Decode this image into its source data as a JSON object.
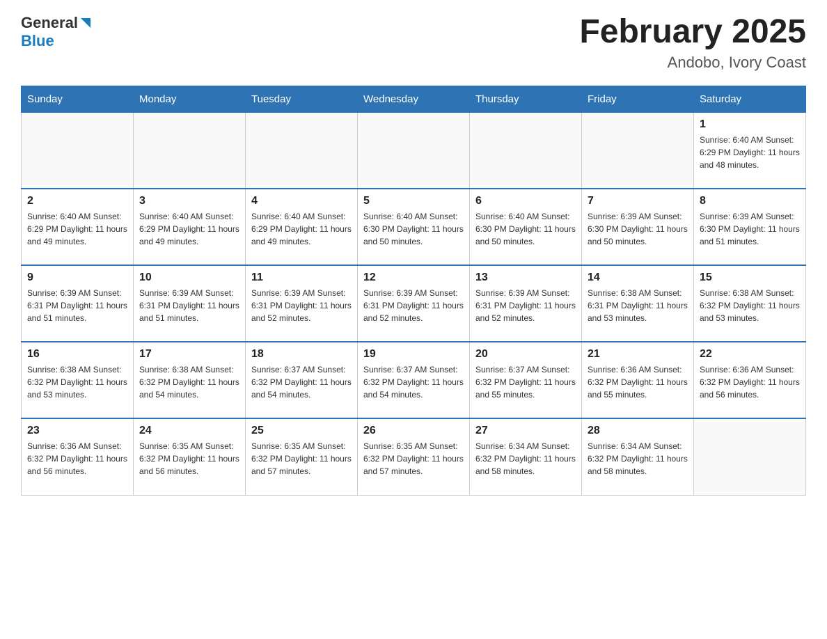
{
  "header": {
    "logo_general": "General",
    "logo_blue": "Blue",
    "month_title": "February 2025",
    "location": "Andobo, Ivory Coast"
  },
  "weekdays": [
    "Sunday",
    "Monday",
    "Tuesday",
    "Wednesday",
    "Thursday",
    "Friday",
    "Saturday"
  ],
  "weeks": [
    [
      {
        "day": "",
        "info": ""
      },
      {
        "day": "",
        "info": ""
      },
      {
        "day": "",
        "info": ""
      },
      {
        "day": "",
        "info": ""
      },
      {
        "day": "",
        "info": ""
      },
      {
        "day": "",
        "info": ""
      },
      {
        "day": "1",
        "info": "Sunrise: 6:40 AM\nSunset: 6:29 PM\nDaylight: 11 hours\nand 48 minutes."
      }
    ],
    [
      {
        "day": "2",
        "info": "Sunrise: 6:40 AM\nSunset: 6:29 PM\nDaylight: 11 hours\nand 49 minutes."
      },
      {
        "day": "3",
        "info": "Sunrise: 6:40 AM\nSunset: 6:29 PM\nDaylight: 11 hours\nand 49 minutes."
      },
      {
        "day": "4",
        "info": "Sunrise: 6:40 AM\nSunset: 6:29 PM\nDaylight: 11 hours\nand 49 minutes."
      },
      {
        "day": "5",
        "info": "Sunrise: 6:40 AM\nSunset: 6:30 PM\nDaylight: 11 hours\nand 50 minutes."
      },
      {
        "day": "6",
        "info": "Sunrise: 6:40 AM\nSunset: 6:30 PM\nDaylight: 11 hours\nand 50 minutes."
      },
      {
        "day": "7",
        "info": "Sunrise: 6:39 AM\nSunset: 6:30 PM\nDaylight: 11 hours\nand 50 minutes."
      },
      {
        "day": "8",
        "info": "Sunrise: 6:39 AM\nSunset: 6:30 PM\nDaylight: 11 hours\nand 51 minutes."
      }
    ],
    [
      {
        "day": "9",
        "info": "Sunrise: 6:39 AM\nSunset: 6:31 PM\nDaylight: 11 hours\nand 51 minutes."
      },
      {
        "day": "10",
        "info": "Sunrise: 6:39 AM\nSunset: 6:31 PM\nDaylight: 11 hours\nand 51 minutes."
      },
      {
        "day": "11",
        "info": "Sunrise: 6:39 AM\nSunset: 6:31 PM\nDaylight: 11 hours\nand 52 minutes."
      },
      {
        "day": "12",
        "info": "Sunrise: 6:39 AM\nSunset: 6:31 PM\nDaylight: 11 hours\nand 52 minutes."
      },
      {
        "day": "13",
        "info": "Sunrise: 6:39 AM\nSunset: 6:31 PM\nDaylight: 11 hours\nand 52 minutes."
      },
      {
        "day": "14",
        "info": "Sunrise: 6:38 AM\nSunset: 6:31 PM\nDaylight: 11 hours\nand 53 minutes."
      },
      {
        "day": "15",
        "info": "Sunrise: 6:38 AM\nSunset: 6:32 PM\nDaylight: 11 hours\nand 53 minutes."
      }
    ],
    [
      {
        "day": "16",
        "info": "Sunrise: 6:38 AM\nSunset: 6:32 PM\nDaylight: 11 hours\nand 53 minutes."
      },
      {
        "day": "17",
        "info": "Sunrise: 6:38 AM\nSunset: 6:32 PM\nDaylight: 11 hours\nand 54 minutes."
      },
      {
        "day": "18",
        "info": "Sunrise: 6:37 AM\nSunset: 6:32 PM\nDaylight: 11 hours\nand 54 minutes."
      },
      {
        "day": "19",
        "info": "Sunrise: 6:37 AM\nSunset: 6:32 PM\nDaylight: 11 hours\nand 54 minutes."
      },
      {
        "day": "20",
        "info": "Sunrise: 6:37 AM\nSunset: 6:32 PM\nDaylight: 11 hours\nand 55 minutes."
      },
      {
        "day": "21",
        "info": "Sunrise: 6:36 AM\nSunset: 6:32 PM\nDaylight: 11 hours\nand 55 minutes."
      },
      {
        "day": "22",
        "info": "Sunrise: 6:36 AM\nSunset: 6:32 PM\nDaylight: 11 hours\nand 56 minutes."
      }
    ],
    [
      {
        "day": "23",
        "info": "Sunrise: 6:36 AM\nSunset: 6:32 PM\nDaylight: 11 hours\nand 56 minutes."
      },
      {
        "day": "24",
        "info": "Sunrise: 6:35 AM\nSunset: 6:32 PM\nDaylight: 11 hours\nand 56 minutes."
      },
      {
        "day": "25",
        "info": "Sunrise: 6:35 AM\nSunset: 6:32 PM\nDaylight: 11 hours\nand 57 minutes."
      },
      {
        "day": "26",
        "info": "Sunrise: 6:35 AM\nSunset: 6:32 PM\nDaylight: 11 hours\nand 57 minutes."
      },
      {
        "day": "27",
        "info": "Sunrise: 6:34 AM\nSunset: 6:32 PM\nDaylight: 11 hours\nand 58 minutes."
      },
      {
        "day": "28",
        "info": "Sunrise: 6:34 AM\nSunset: 6:32 PM\nDaylight: 11 hours\nand 58 minutes."
      },
      {
        "day": "",
        "info": ""
      }
    ]
  ]
}
